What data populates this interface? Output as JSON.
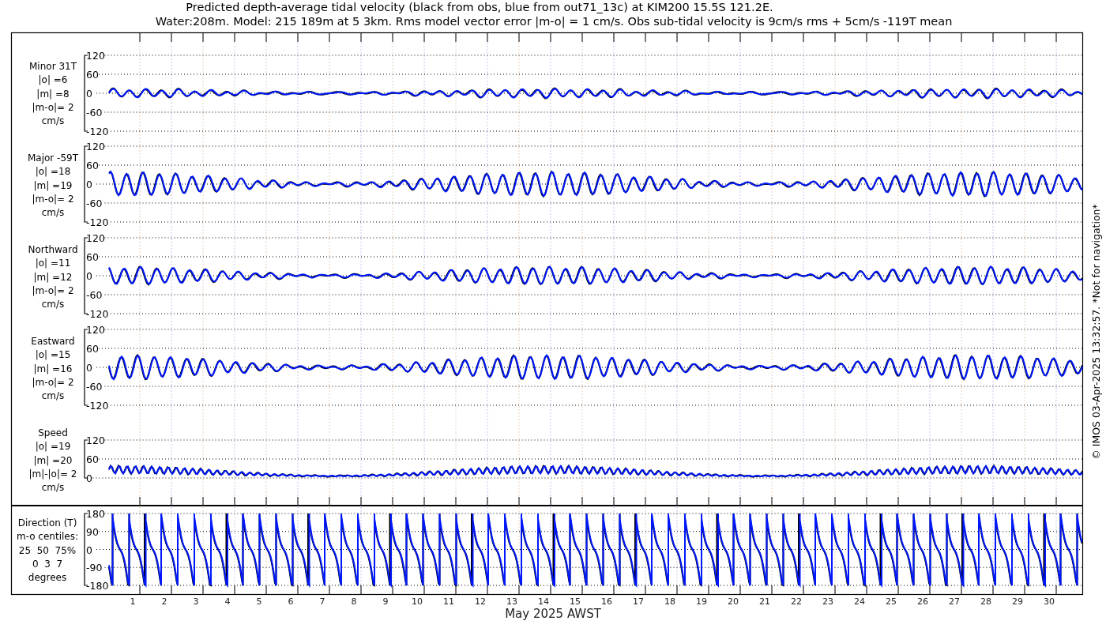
{
  "title_lines": [
    "Predicted depth-average tidal velocity (black from obs, blue from out71_13c) at KIM200 15.5S 121.2E.",
    "Water:208m. Model: 215 189m at 5 3km. Rms model vector error |m-o| = 1 cm/s. Obs sub-tidal velocity is 9cm/s rms + 5cm/s -119T mean"
  ],
  "panels": [
    {
      "kind": "minor",
      "label_lines": [
        "Minor 31T",
        "|o| =6",
        "|m| =8",
        "|m-o|= 2",
        "cm/s"
      ],
      "yticks": [
        "120",
        "60",
        "0",
        "-60",
        "-120"
      ]
    },
    {
      "kind": "major",
      "label_lines": [
        "Major -59T",
        "|o| =18",
        "|m| =19",
        "|m-o|= 2",
        "cm/s"
      ],
      "yticks": [
        "120",
        "60",
        "0",
        "-60",
        "-120"
      ]
    },
    {
      "kind": "northward",
      "label_lines": [
        "Northward",
        "|o| =11",
        "|m| =12",
        "|m-o|= 2",
        "cm/s"
      ],
      "yticks": [
        "120",
        "60",
        "0",
        "-60",
        "-120"
      ]
    },
    {
      "kind": "eastward",
      "label_lines": [
        "Eastward",
        "|o| =15",
        "|m| =16",
        "|m-o|= 2",
        "cm/s"
      ],
      "yticks": [
        "120",
        "60",
        "0",
        "-60",
        "-120"
      ]
    },
    {
      "kind": "speed",
      "label_lines": [
        "Speed",
        "|o| =19",
        "|m| =20",
        "|m|-|o|= 2",
        "cm/s"
      ],
      "yticks": [
        "120",
        "60",
        "0"
      ]
    },
    {
      "kind": "direction",
      "label_lines": [
        "Direction (T)",
        "m-o centiles:",
        "25  50  75%",
        "0  3  7",
        "degrees"
      ],
      "yticks": [
        "180",
        "90",
        "0",
        "-90",
        "-180"
      ]
    }
  ],
  "xticks": [
    "1",
    "2",
    "3",
    "4",
    "5",
    "6",
    "7",
    "8",
    "9",
    "10",
    "11",
    "12",
    "13",
    "14",
    "15",
    "16",
    "17",
    "18",
    "19",
    "20",
    "21",
    "22",
    "23",
    "24",
    "25",
    "26",
    "27",
    "28",
    "29",
    "30"
  ],
  "xlabel": "May 2025 AWST",
  "credit": "© IMOS 03-Apr-2025 13:32:57. *Not for navigation*"
}
